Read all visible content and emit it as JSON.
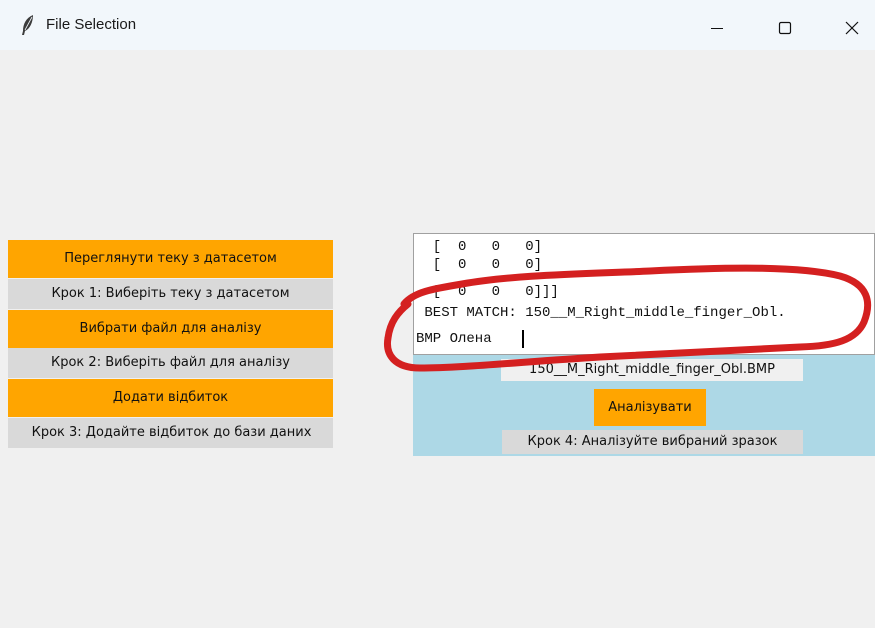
{
  "window": {
    "title": "File Selection",
    "app_icon": "feather-icon",
    "controls": [
      "minimize-icon",
      "maximize-icon",
      "close-icon"
    ]
  },
  "left_panel": {
    "browse_dataset_button": "Переглянути теку з датасетом",
    "step1_label": "Крок 1: Виберіть теку з датасетом",
    "choose_file_button": "Вибрати файл для аналізу",
    "step2_label": "Крок 2: Виберіть файл для аналізу",
    "add_print_button": "Додати відбиток",
    "step3_label": "Крок 3: Додайте відбиток до бази даних"
  },
  "right_panel": {
    "output_lines": [
      "  [  0   0   0]",
      "  [  0   0   0]",
      "  [  0   0   0]]]",
      " BEST MATCH: 150__M_Right_middle_finger_Obl.",
      "BMP Олена"
    ],
    "selected_file": "150__M_Right_middle_finger_Obl.BMP",
    "analyze_button": "Аналізувати",
    "step4_label": "Крок 4: Аналізуйте вибраний зразок"
  },
  "colors": {
    "button_bg": "#ffa500",
    "label_bg": "#d9d9d9",
    "panel_bg": "#add8e6",
    "window_bg": "#f0f0f0",
    "annotation": "#d42020"
  }
}
